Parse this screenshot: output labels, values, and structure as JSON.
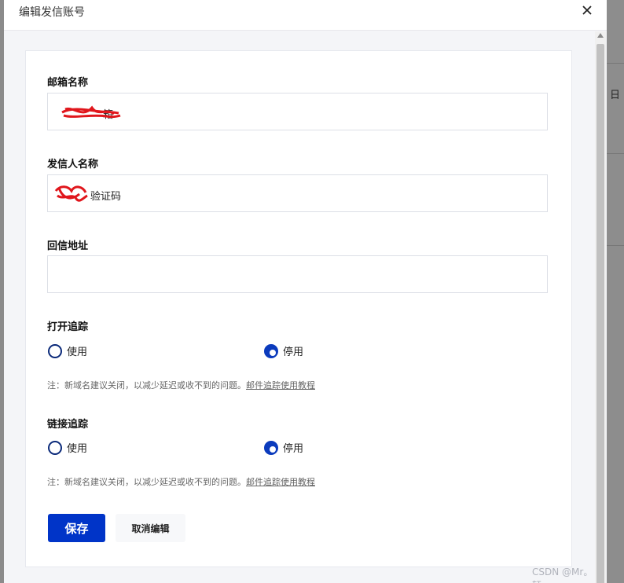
{
  "dialog": {
    "title": "编辑发信账号",
    "close_icon": "close-icon"
  },
  "form": {
    "email_name": {
      "label": "邮箱名称",
      "value": "箱"
    },
    "sender_name": {
      "label": "发信人名称",
      "value": "验证码"
    },
    "reply_address": {
      "label": "回信地址",
      "value": ""
    },
    "open_tracking": {
      "label": "打开追踪",
      "options": [
        "使用",
        "停用"
      ],
      "selected": "停用",
      "note": "注：新域名建议关闭，以减少延迟或收不到的问题。",
      "note_link": "邮件追踪使用教程"
    },
    "link_tracking": {
      "label": "链接追踪",
      "options": [
        "使用",
        "停用"
      ],
      "selected": "停用",
      "note": "注：新域名建议关闭，以减少延迟或收不到的问题。",
      "note_link": "邮件追踪使用教程"
    }
  },
  "actions": {
    "save_label": "保存",
    "cancel_label": "取消编辑"
  },
  "background": {
    "glyph": "日"
  },
  "watermark": "CSDN @Mr。轩。",
  "colors": {
    "primary": "#0034c8",
    "radio_checked": "#0b3bbd"
  }
}
